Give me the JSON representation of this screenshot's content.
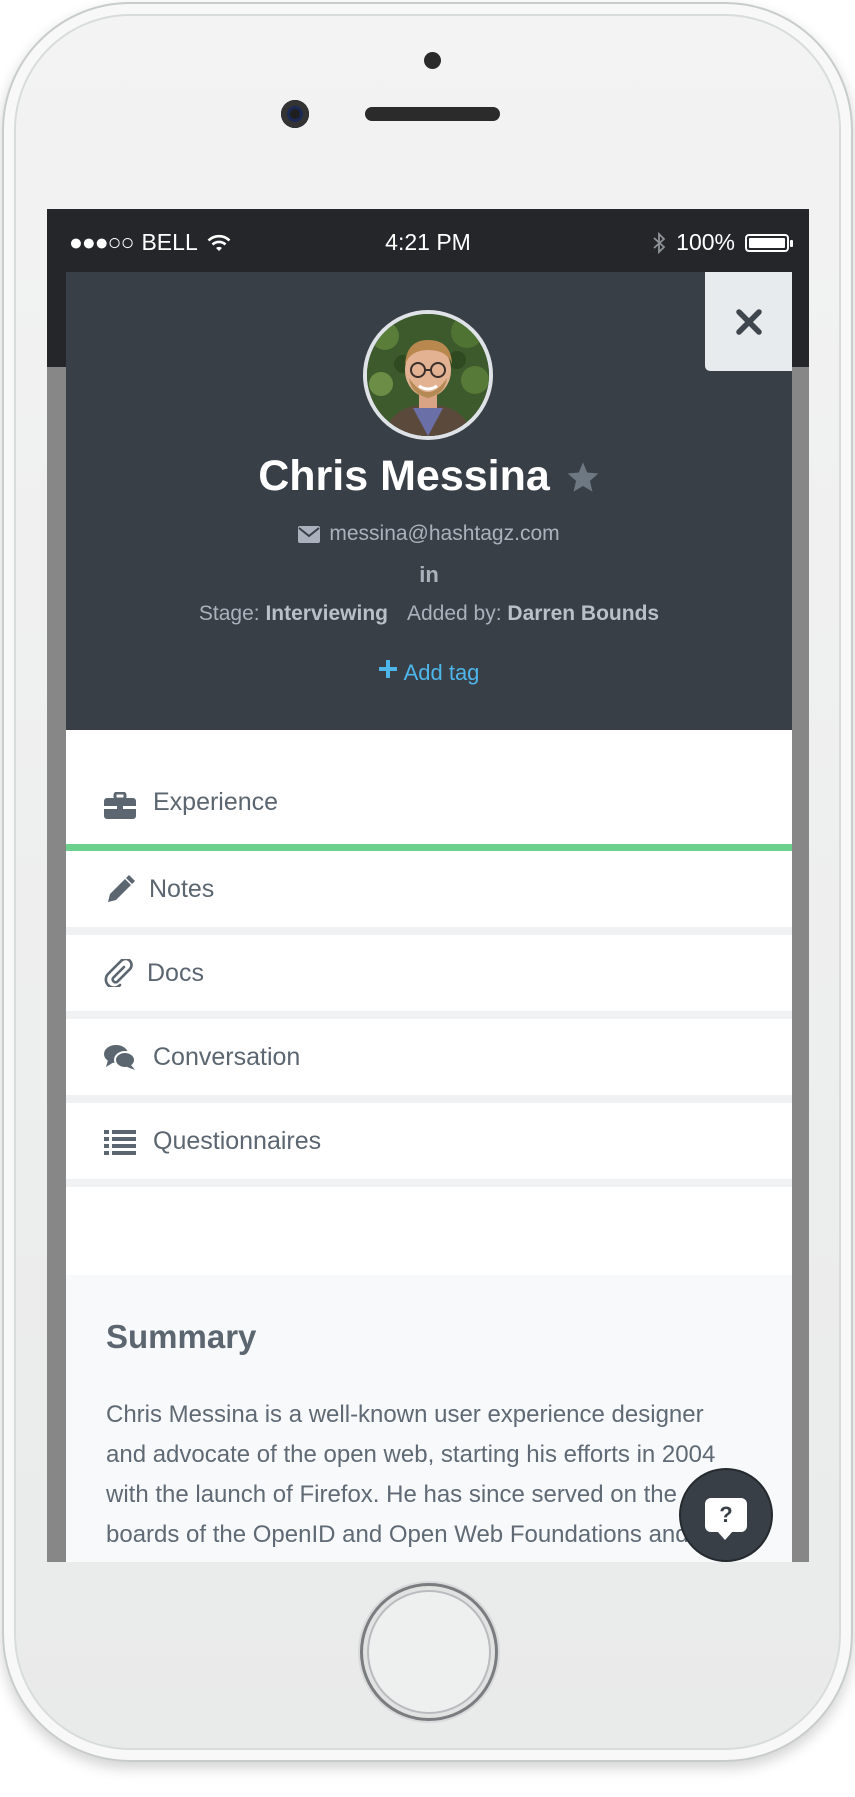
{
  "status_bar": {
    "signal": "●●●○○",
    "carrier": "BELL",
    "time": "4:21 PM",
    "battery": "100%"
  },
  "close": {
    "label": "✕"
  },
  "profile": {
    "name": "Chris Messina",
    "email": "messina@hashtagz.com",
    "linkedin": "in",
    "stage_label": "Stage:",
    "stage_value": "Interviewing",
    "added_label": "Added by:",
    "added_value": "Darren Bounds",
    "add_tag": "Add tag"
  },
  "tabs": [
    {
      "label": "Experience",
      "icon": "briefcase-icon",
      "active": true
    },
    {
      "label": "Notes",
      "icon": "pencil-icon",
      "active": false
    },
    {
      "label": "Docs",
      "icon": "paperclip-icon",
      "active": false
    },
    {
      "label": "Conversation",
      "icon": "chat-bubbles-icon",
      "active": false
    },
    {
      "label": "Questionnaires",
      "icon": "list-icon",
      "active": false
    }
  ],
  "summary": {
    "title": "Summary",
    "text": "Chris Messina is a well-known user experience designer and advocate of the open web, starting his efforts in 2004 with the launch of Firefox. He has since served on the boards of the OpenID and Open Web Foundations and played an instrumental role in the industry-wide"
  },
  "help": {
    "label": "?"
  },
  "colors": {
    "header_bg": "#393f47",
    "accent_green": "#6cd08d",
    "link_blue": "#4db6ea"
  }
}
